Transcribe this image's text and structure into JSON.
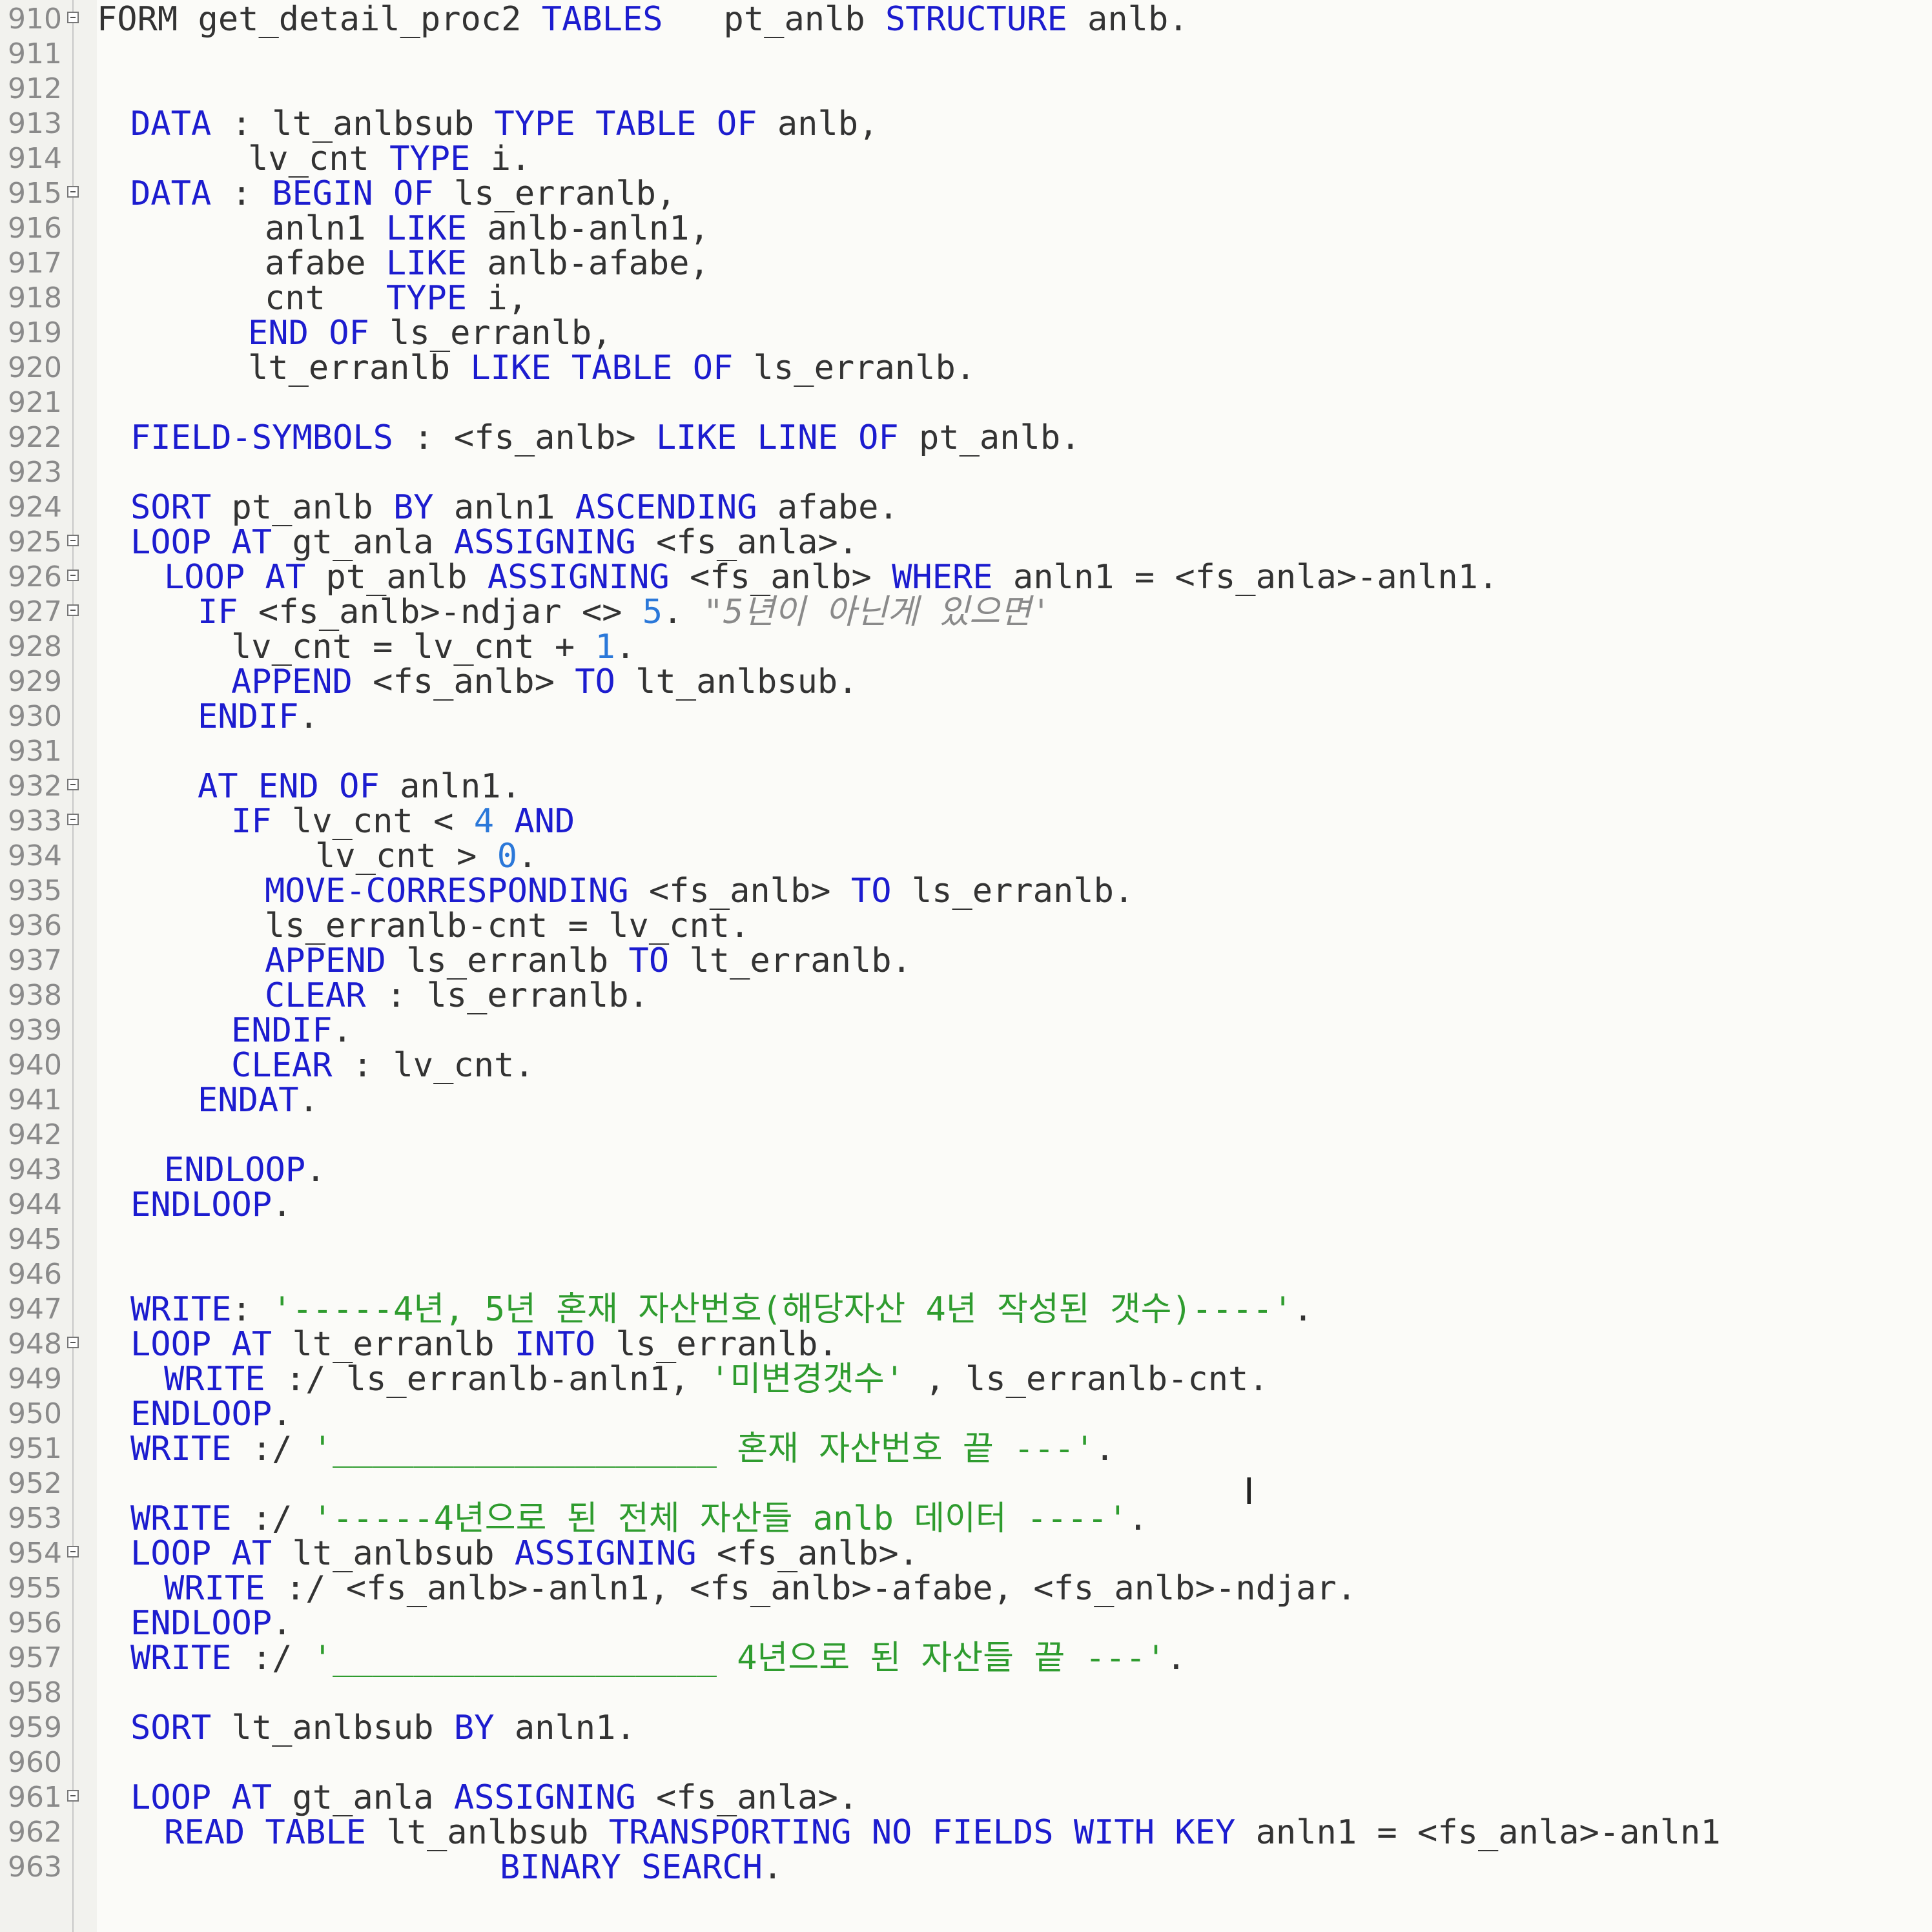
{
  "editor": {
    "icons": {
      "fold": "fold-minus-icon",
      "cursor": "text-cursor-icon"
    },
    "colors": {
      "keyword": "#1c1ccf",
      "number": "#2b78d9",
      "string": "#2f9c2f",
      "comment": "#8a8a8a",
      "text": "#333333",
      "line_number": "#8a8a8a"
    },
    "lines": [
      {
        "n": "910",
        "indent": 0,
        "fold": true,
        "tokens": [
          {
            "k": "tx",
            "t": "FORM "
          },
          {
            "k": "tx",
            "t": "get_detail_proc2 "
          },
          {
            "k": "kw",
            "t": "TABLES"
          },
          {
            "k": "tx",
            "t": "   pt_anlb "
          },
          {
            "k": "kw",
            "t": "STRUCTURE"
          },
          {
            "k": "tx",
            "t": " anlb."
          }
        ]
      },
      {
        "n": "911",
        "indent": 0,
        "fold": false,
        "tokens": []
      },
      {
        "n": "912",
        "indent": 0,
        "fold": false,
        "tokens": []
      },
      {
        "n": "913",
        "indent": 2,
        "fold": false,
        "tokens": [
          {
            "k": "kw",
            "t": "DATA"
          },
          {
            "k": "tx",
            "t": " : lt_anlbsub "
          },
          {
            "k": "kw",
            "t": "TYPE TABLE OF"
          },
          {
            "k": "tx",
            "t": " anlb,"
          }
        ]
      },
      {
        "n": "914",
        "indent": 9,
        "fold": false,
        "tokens": [
          {
            "k": "tx",
            "t": "lv_cnt "
          },
          {
            "k": "kw",
            "t": "TYPE"
          },
          {
            "k": "tx",
            "t": " i."
          }
        ]
      },
      {
        "n": "915",
        "indent": 2,
        "fold": true,
        "tokens": [
          {
            "k": "kw",
            "t": "DATA"
          },
          {
            "k": "tx",
            "t": " : "
          },
          {
            "k": "kw",
            "t": "BEGIN OF"
          },
          {
            "k": "tx",
            "t": " ls_erranlb,"
          }
        ]
      },
      {
        "n": "916",
        "indent": 10,
        "fold": false,
        "tokens": [
          {
            "k": "tx",
            "t": "anln1 "
          },
          {
            "k": "kw",
            "t": "LIKE"
          },
          {
            "k": "tx",
            "t": " anlb-anln1,"
          }
        ]
      },
      {
        "n": "917",
        "indent": 10,
        "fold": false,
        "tokens": [
          {
            "k": "tx",
            "t": "afabe "
          },
          {
            "k": "kw",
            "t": "LIKE"
          },
          {
            "k": "tx",
            "t": " anlb-afabe,"
          }
        ]
      },
      {
        "n": "918",
        "indent": 10,
        "fold": false,
        "tokens": [
          {
            "k": "tx",
            "t": "cnt   "
          },
          {
            "k": "kw",
            "t": "TYPE"
          },
          {
            "k": "tx",
            "t": " i,"
          }
        ]
      },
      {
        "n": "919",
        "indent": 9,
        "fold": false,
        "tokens": [
          {
            "k": "kw",
            "t": "END OF"
          },
          {
            "k": "tx",
            "t": " ls_erranlb,"
          }
        ]
      },
      {
        "n": "920",
        "indent": 9,
        "fold": false,
        "tokens": [
          {
            "k": "tx",
            "t": "lt_erranlb "
          },
          {
            "k": "kw",
            "t": "LIKE TABLE OF"
          },
          {
            "k": "tx",
            "t": " ls_erranlb."
          }
        ]
      },
      {
        "n": "921",
        "indent": 0,
        "fold": false,
        "tokens": []
      },
      {
        "n": "922",
        "indent": 2,
        "fold": false,
        "tokens": [
          {
            "k": "kw",
            "t": "FIELD-SYMBOLS"
          },
          {
            "k": "tx",
            "t": " : <fs_anlb> "
          },
          {
            "k": "kw",
            "t": "LIKE LINE OF"
          },
          {
            "k": "tx",
            "t": " pt_anlb."
          }
        ]
      },
      {
        "n": "923",
        "indent": 0,
        "fold": false,
        "tokens": []
      },
      {
        "n": "924",
        "indent": 2,
        "fold": false,
        "tokens": [
          {
            "k": "kw",
            "t": "SORT"
          },
          {
            "k": "tx",
            "t": " pt_anlb "
          },
          {
            "k": "kw",
            "t": "BY"
          },
          {
            "k": "tx",
            "t": " anln1 "
          },
          {
            "k": "kw",
            "t": "ASCENDING"
          },
          {
            "k": "tx",
            "t": " afabe."
          }
        ]
      },
      {
        "n": "925",
        "indent": 2,
        "fold": true,
        "tokens": [
          {
            "k": "kw",
            "t": "LOOP AT"
          },
          {
            "k": "tx",
            "t": " gt_anla "
          },
          {
            "k": "kw",
            "t": "ASSIGNING"
          },
          {
            "k": "tx",
            "t": " <fs_anla>."
          }
        ]
      },
      {
        "n": "926",
        "indent": 4,
        "fold": true,
        "tokens": [
          {
            "k": "kw",
            "t": "LOOP AT"
          },
          {
            "k": "tx",
            "t": " pt_anlb "
          },
          {
            "k": "kw",
            "t": "ASSIGNING"
          },
          {
            "k": "tx",
            "t": " <fs_anlb> "
          },
          {
            "k": "kw",
            "t": "WHERE"
          },
          {
            "k": "tx",
            "t": " anln1 = <fs_anla>-anln1."
          }
        ]
      },
      {
        "n": "927",
        "indent": 6,
        "fold": true,
        "tokens": [
          {
            "k": "kw",
            "t": "IF"
          },
          {
            "k": "tx",
            "t": " <fs_anlb>-ndjar <> "
          },
          {
            "k": "num",
            "t": "5"
          },
          {
            "k": "tx",
            "t": ". "
          },
          {
            "k": "cmt",
            "t": "\"5년이 아닌게 있으면'"
          }
        ]
      },
      {
        "n": "928",
        "indent": 8,
        "fold": false,
        "tokens": [
          {
            "k": "tx",
            "t": "lv_cnt = lv_cnt + "
          },
          {
            "k": "num",
            "t": "1"
          },
          {
            "k": "tx",
            "t": "."
          }
        ]
      },
      {
        "n": "929",
        "indent": 8,
        "fold": false,
        "tokens": [
          {
            "k": "kw",
            "t": "APPEND"
          },
          {
            "k": "tx",
            "t": " <fs_anlb> "
          },
          {
            "k": "kw",
            "t": "TO"
          },
          {
            "k": "tx",
            "t": " lt_anlbsub."
          }
        ]
      },
      {
        "n": "930",
        "indent": 6,
        "fold": false,
        "tokens": [
          {
            "k": "kw",
            "t": "ENDIF"
          },
          {
            "k": "tx",
            "t": "."
          }
        ]
      },
      {
        "n": "931",
        "indent": 0,
        "fold": false,
        "tokens": []
      },
      {
        "n": "932",
        "indent": 6,
        "fold": true,
        "tokens": [
          {
            "k": "kw",
            "t": "AT END OF"
          },
          {
            "k": "tx",
            "t": " anln1."
          }
        ]
      },
      {
        "n": "933",
        "indent": 8,
        "fold": true,
        "tokens": [
          {
            "k": "kw",
            "t": "IF"
          },
          {
            "k": "tx",
            "t": " lv_cnt < "
          },
          {
            "k": "num",
            "t": "4"
          },
          {
            "k": "kw",
            "t": " AND"
          }
        ]
      },
      {
        "n": "934",
        "indent": 13,
        "fold": false,
        "tokens": [
          {
            "k": "tx",
            "t": "lv_cnt > "
          },
          {
            "k": "num",
            "t": "0"
          },
          {
            "k": "tx",
            "t": "."
          }
        ]
      },
      {
        "n": "935",
        "indent": 10,
        "fold": false,
        "tokens": [
          {
            "k": "kw",
            "t": "MOVE-CORRESPONDING"
          },
          {
            "k": "tx",
            "t": " <fs_anlb> "
          },
          {
            "k": "kw",
            "t": "TO"
          },
          {
            "k": "tx",
            "t": " ls_erranlb."
          }
        ]
      },
      {
        "n": "936",
        "indent": 10,
        "fold": false,
        "tokens": [
          {
            "k": "tx",
            "t": "ls_erranlb-cnt = lv_cnt."
          }
        ]
      },
      {
        "n": "937",
        "indent": 10,
        "fold": false,
        "tokens": [
          {
            "k": "kw",
            "t": "APPEND"
          },
          {
            "k": "tx",
            "t": " ls_erranlb "
          },
          {
            "k": "kw",
            "t": "TO"
          },
          {
            "k": "tx",
            "t": " lt_erranlb."
          }
        ]
      },
      {
        "n": "938",
        "indent": 10,
        "fold": false,
        "tokens": [
          {
            "k": "kw",
            "t": "CLEAR"
          },
          {
            "k": "tx",
            "t": " : ls_erranlb."
          }
        ]
      },
      {
        "n": "939",
        "indent": 8,
        "fold": false,
        "tokens": [
          {
            "k": "kw",
            "t": "ENDIF"
          },
          {
            "k": "tx",
            "t": "."
          }
        ]
      },
      {
        "n": "940",
        "indent": 8,
        "fold": false,
        "tokens": [
          {
            "k": "kw",
            "t": "CLEAR"
          },
          {
            "k": "tx",
            "t": " : lv_cnt."
          }
        ]
      },
      {
        "n": "941",
        "indent": 6,
        "fold": false,
        "tokens": [
          {
            "k": "kw",
            "t": "ENDAT"
          },
          {
            "k": "tx",
            "t": "."
          }
        ]
      },
      {
        "n": "942",
        "indent": 0,
        "fold": false,
        "tokens": []
      },
      {
        "n": "943",
        "indent": 4,
        "fold": false,
        "tokens": [
          {
            "k": "kw",
            "t": "ENDLOOP"
          },
          {
            "k": "tx",
            "t": "."
          }
        ]
      },
      {
        "n": "944",
        "indent": 2,
        "fold": false,
        "tokens": [
          {
            "k": "kw",
            "t": "ENDLOOP"
          },
          {
            "k": "tx",
            "t": "."
          }
        ]
      },
      {
        "n": "945",
        "indent": 0,
        "fold": false,
        "tokens": []
      },
      {
        "n": "946",
        "indent": 0,
        "fold": false,
        "tokens": []
      },
      {
        "n": "947",
        "indent": 2,
        "fold": false,
        "tokens": [
          {
            "k": "kw",
            "t": "WRITE"
          },
          {
            "k": "tx",
            "t": ": "
          },
          {
            "k": "str",
            "t": "'-----4년, 5년 혼재 자산번호(해당자산 4년 작성된 갯수)----'"
          },
          {
            "k": "tx",
            "t": "."
          }
        ]
      },
      {
        "n": "948",
        "indent": 2,
        "fold": true,
        "tokens": [
          {
            "k": "kw",
            "t": "LOOP AT"
          },
          {
            "k": "tx",
            "t": " lt_erranlb "
          },
          {
            "k": "kw",
            "t": "INTO"
          },
          {
            "k": "tx",
            "t": " ls_erranlb."
          }
        ]
      },
      {
        "n": "949",
        "indent": 4,
        "fold": false,
        "tokens": [
          {
            "k": "kw",
            "t": "WRITE"
          },
          {
            "k": "tx",
            "t": " :/ ls_erranlb-anln1, "
          },
          {
            "k": "str",
            "t": "'미변경갯수'"
          },
          {
            "k": "tx",
            "t": " , ls_erranlb-cnt."
          }
        ]
      },
      {
        "n": "950",
        "indent": 2,
        "fold": false,
        "tokens": [
          {
            "k": "kw",
            "t": "ENDLOOP"
          },
          {
            "k": "tx",
            "t": "."
          }
        ]
      },
      {
        "n": "951",
        "indent": 2,
        "fold": false,
        "tokens": [
          {
            "k": "kw",
            "t": "WRITE"
          },
          {
            "k": "tx",
            "t": " :/ "
          },
          {
            "k": "str",
            "t": "'___________________ 혼재 자산번호 끝 ---'"
          },
          {
            "k": "tx",
            "t": "."
          }
        ]
      },
      {
        "n": "952",
        "indent": 0,
        "fold": false,
        "tokens": []
      },
      {
        "n": "953",
        "indent": 2,
        "fold": false,
        "tokens": [
          {
            "k": "kw",
            "t": "WRITE"
          },
          {
            "k": "tx",
            "t": " :/ "
          },
          {
            "k": "str",
            "t": "'-----4년으로 된 전체 자산들 anlb 데이터 ----'"
          },
          {
            "k": "tx",
            "t": "."
          }
        ]
      },
      {
        "n": "954",
        "indent": 2,
        "fold": true,
        "tokens": [
          {
            "k": "kw",
            "t": "LOOP AT"
          },
          {
            "k": "tx",
            "t": " lt_anlbsub "
          },
          {
            "k": "kw",
            "t": "ASSIGNING"
          },
          {
            "k": "tx",
            "t": " <fs_anlb>."
          }
        ]
      },
      {
        "n": "955",
        "indent": 4,
        "fold": false,
        "tokens": [
          {
            "k": "kw",
            "t": "WRITE"
          },
          {
            "k": "tx",
            "t": " :/ <fs_anlb>-anln1, <fs_anlb>-afabe, <fs_anlb>-ndjar."
          }
        ]
      },
      {
        "n": "956",
        "indent": 2,
        "fold": false,
        "tokens": [
          {
            "k": "kw",
            "t": "ENDLOOP"
          },
          {
            "k": "tx",
            "t": "."
          }
        ]
      },
      {
        "n": "957",
        "indent": 2,
        "fold": false,
        "tokens": [
          {
            "k": "kw",
            "t": "WRITE"
          },
          {
            "k": "tx",
            "t": " :/ "
          },
          {
            "k": "str",
            "t": "'___________________ 4년으로 된 자산들 끝 ---'"
          },
          {
            "k": "tx",
            "t": "."
          }
        ]
      },
      {
        "n": "958",
        "indent": 0,
        "fold": false,
        "tokens": []
      },
      {
        "n": "959",
        "indent": 2,
        "fold": false,
        "tokens": [
          {
            "k": "kw",
            "t": "SORT"
          },
          {
            "k": "tx",
            "t": " lt_anlbsub "
          },
          {
            "k": "kw",
            "t": "BY"
          },
          {
            "k": "tx",
            "t": " anln1."
          }
        ]
      },
      {
        "n": "960",
        "indent": 0,
        "fold": false,
        "tokens": []
      },
      {
        "n": "961",
        "indent": 2,
        "fold": true,
        "tokens": [
          {
            "k": "kw",
            "t": "LOOP AT"
          },
          {
            "k": "tx",
            "t": " gt_anla "
          },
          {
            "k": "kw",
            "t": "ASSIGNING"
          },
          {
            "k": "tx",
            "t": " <fs_anla>."
          }
        ]
      },
      {
        "n": "962",
        "indent": 4,
        "fold": false,
        "tokens": [
          {
            "k": "kw",
            "t": "READ TABLE"
          },
          {
            "k": "tx",
            "t": " lt_anlbsub "
          },
          {
            "k": "kw",
            "t": "TRANSPORTING NO FIELDS WITH KEY"
          },
          {
            "k": "tx",
            "t": " anln1 = <fs_anla>-anln1"
          }
        ]
      },
      {
        "n": "963",
        "indent": 24,
        "fold": false,
        "tokens": [
          {
            "k": "kw",
            "t": "BINARY SEARCH"
          },
          {
            "k": "tx",
            "t": "."
          }
        ]
      }
    ]
  }
}
